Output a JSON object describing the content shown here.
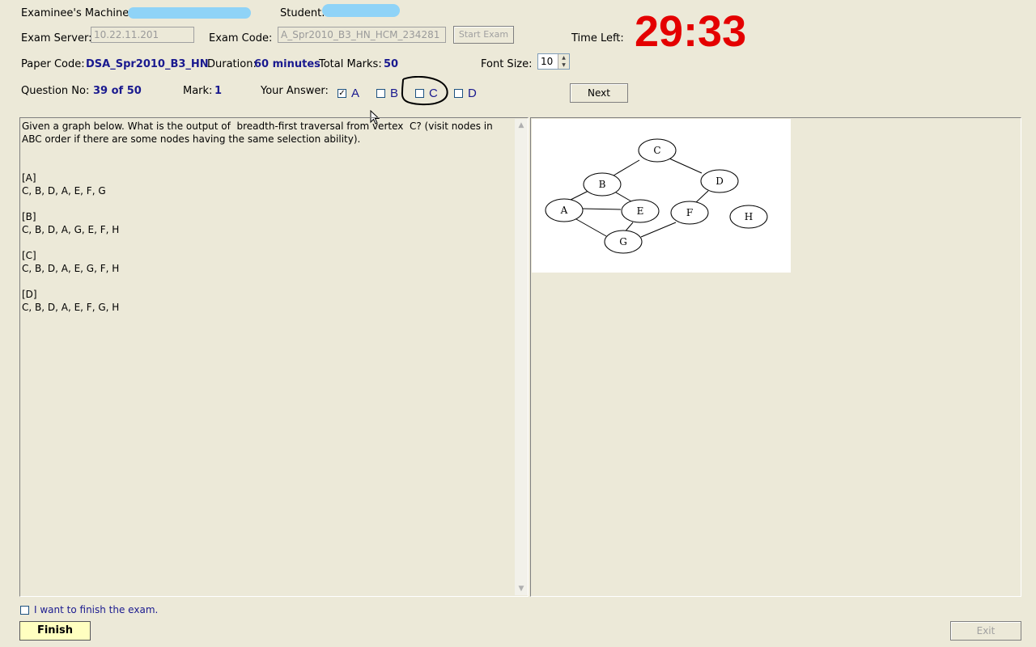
{
  "header": {
    "machine_label": "Examinee's Machine:",
    "student_label": "Student:",
    "server_label": "Exam Server:",
    "server_value": "10.22.11.201",
    "exam_code_label": "Exam Code:",
    "exam_code_value": "A_Spr2010_B3_HN_HCM_234281",
    "start_exam_label": "Start Exam",
    "time_left_label": "Time Left:",
    "time_left_value": "29:33",
    "paper_code_label": "Paper Code:",
    "paper_code_value": "DSA_Spr2010_B3_HN",
    "duration_label": "Duration:",
    "duration_value": "60 minutes",
    "total_marks_label": "Total Marks:",
    "total_marks_value": "50",
    "font_size_label": "Font Size:",
    "font_size_value": "10"
  },
  "question_bar": {
    "question_no_label": "Question No:",
    "question_no_value": "39 of 50",
    "mark_label": "Mark:",
    "mark_value": "1",
    "your_answer_label": "Your Answer:",
    "options": [
      {
        "letter": "A",
        "checked": true
      },
      {
        "letter": "B",
        "checked": false
      },
      {
        "letter": "C",
        "checked": false
      },
      {
        "letter": "D",
        "checked": false
      }
    ],
    "next_label": "Next"
  },
  "question": {
    "text": "Given a graph below. What is the output of  breadth-first traversal from vertex  C? (visit nodes in ABC order if there are some nodes having the same selection ability).",
    "answers": [
      {
        "tag": "[A]",
        "text": "C, B, D, A, E, F, G"
      },
      {
        "tag": "[B]",
        "text": "C, B, D, A, G, E, F, H"
      },
      {
        "tag": "[C]",
        "text": "C, B, D, A, E, G, F, H"
      },
      {
        "tag": "[D]",
        "text": "C, B, D, A, E, F, G, H"
      }
    ]
  },
  "graph": {
    "nodes": [
      "C",
      "B",
      "D",
      "A",
      "E",
      "F",
      "H",
      "G"
    ],
    "edges": [
      [
        "C",
        "B"
      ],
      [
        "C",
        "D"
      ],
      [
        "B",
        "A"
      ],
      [
        "B",
        "E"
      ],
      [
        "A",
        "E"
      ],
      [
        "A",
        "G"
      ],
      [
        "E",
        "G"
      ],
      [
        "G",
        "F"
      ],
      [
        "F",
        "D"
      ]
    ]
  },
  "footer": {
    "finish_check_label": "I want to finish the exam.",
    "finish_label": "Finish",
    "exit_label": "Exit"
  },
  "colors": {
    "background": "#ece9d8",
    "timer": "#e40000",
    "value_text": "#1a1a8f",
    "finish_button": "#ffffc0"
  }
}
